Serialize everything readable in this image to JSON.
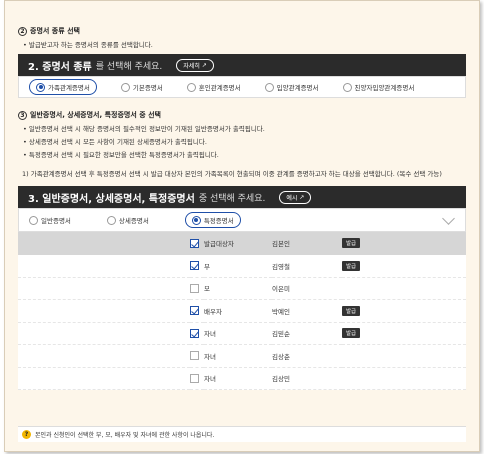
{
  "section2": {
    "num": "2",
    "title": "증명서 종류 선택",
    "bullet": "발급받고자 하는 증명서의 종류를 선택합니다.",
    "bar_strong": "2. 증명서 종류",
    "bar_light": "를 선택해 주세요.",
    "detail": "자세히",
    "options": [
      {
        "label": "가족관계증명서",
        "selected": true
      },
      {
        "label": "기본증명서",
        "selected": false
      },
      {
        "label": "혼인관계증명서",
        "selected": false
      },
      {
        "label": "입양관계증명서",
        "selected": false
      },
      {
        "label": "친양자입양관계증명서",
        "selected": false
      }
    ]
  },
  "section3": {
    "num": "3",
    "title": "일반증명서, 상세증명서, 특정증명서 중 선택",
    "bullets": [
      "일반증명서 선택 시 해당 증명서의 필수적인 정보만이 기재된 일반증명서가 출력됩니다.",
      "상세증명서 선택 시 모든 사항이 기재된 상세증명서가 출력됩니다.",
      "특정증명서 선택 시 필요한 정보만을 선택한 특정증명서가 출력됩니다."
    ],
    "note": "1) 가족관계증명서 선택 후 특정증명서 선택 시 발급 대상자 본인의 가족목록이 현출되며 이중 관계를 증명하고자 하는 대상을 선택합니다. (복수 선택 가능)",
    "bar_strong": "3. 일반증명서, 상세증명서, 특정증명서",
    "bar_light": "중 선택해 주세요.",
    "example": "예시",
    "options": [
      {
        "label": "일반증명서",
        "selected": false
      },
      {
        "label": "상세증명서",
        "selected": false
      },
      {
        "label": "특정증명서",
        "selected": true
      }
    ]
  },
  "family": [
    {
      "relation": "발급대상자",
      "name": "김본인",
      "checked": true,
      "badge": "발급"
    },
    {
      "relation": "부",
      "name": "김영철",
      "checked": true,
      "badge": "발급"
    },
    {
      "relation": "모",
      "name": "이은미",
      "checked": false,
      "badge": ""
    },
    {
      "relation": "배우자",
      "name": "박예인",
      "checked": true,
      "badge": "발급"
    },
    {
      "relation": "자녀",
      "name": "김믿순",
      "checked": true,
      "badge": "발급"
    },
    {
      "relation": "자녀",
      "name": "김상춘",
      "checked": false,
      "badge": ""
    },
    {
      "relation": "자녀",
      "name": "김상민",
      "checked": false,
      "badge": ""
    }
  ],
  "footer": "본인과 신청인이 선택한 부, 모, 배우자 및 자녀에 관한 사항이 나옵니다.",
  "colors": {
    "accent": "#1f4fa8",
    "bar": "#2b2b2b",
    "background": "#fdf6ea",
    "help": "#f2b600"
  }
}
